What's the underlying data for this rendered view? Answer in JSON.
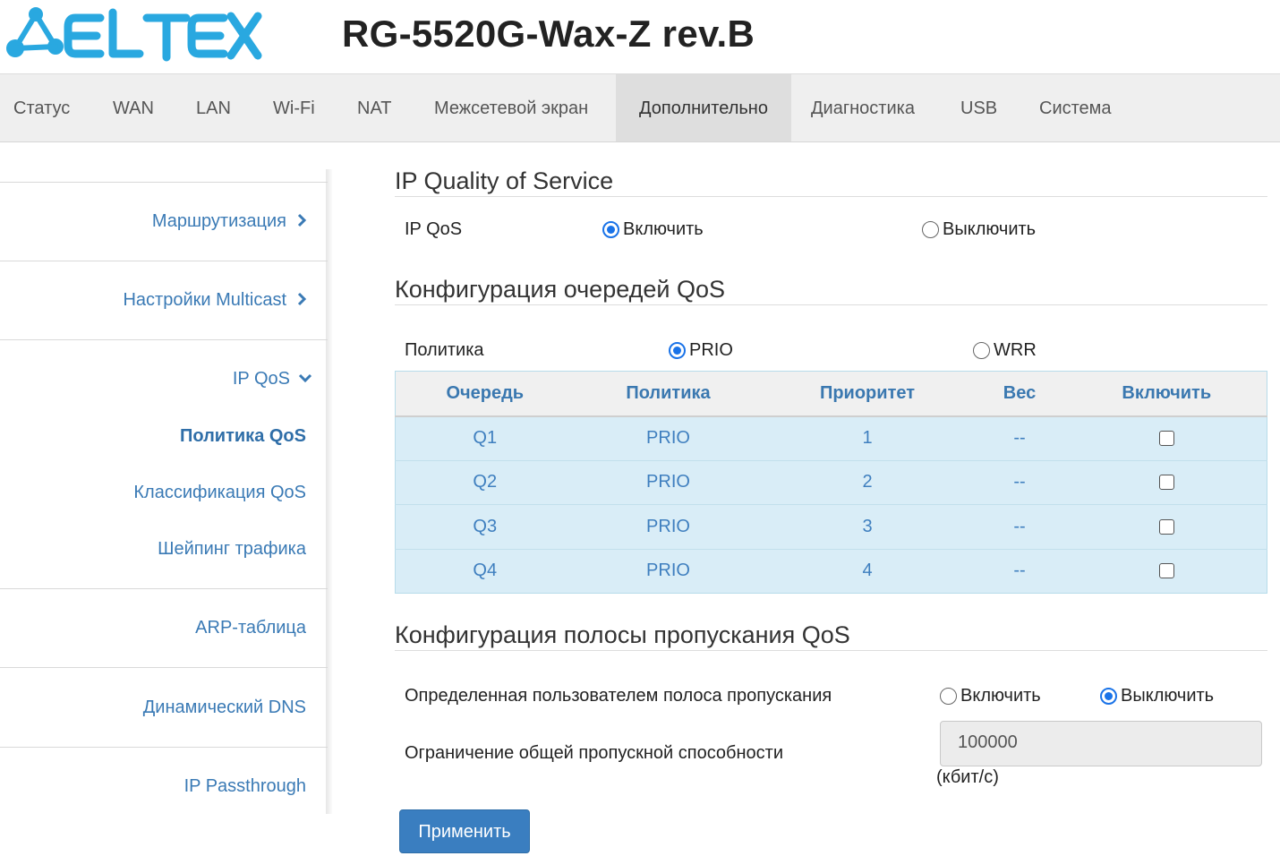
{
  "header": {
    "brand": "ELTEX",
    "model": "RG-5520G-Wax-Z rev.B"
  },
  "colors": {
    "accent": "#3a7ec0",
    "logo": "#29a8e0",
    "table_row": "#d9edf7"
  },
  "topnav": {
    "tabs": [
      "Статус",
      "WAN",
      "LAN",
      "Wi-Fi",
      "NAT",
      "Межсетевой экран",
      "Дополнительно",
      "Диагностика",
      "USB",
      "Система"
    ],
    "active": "Дополнительно"
  },
  "sidebar": {
    "items": [
      {
        "label": "Маршрутизация",
        "icon": "chevron-right-icon"
      },
      {
        "label": "Настройки Multicast",
        "icon": "chevron-right-icon"
      },
      {
        "label": "IP QoS",
        "icon": "chevron-down-icon"
      },
      {
        "label": "Политика QoS",
        "selected": true
      },
      {
        "label": "Классификация QoS"
      },
      {
        "label": "Шейпинг трафика"
      },
      {
        "label": "ARP-таблица"
      },
      {
        "label": "Динамический DNS"
      },
      {
        "label": "IP Passthrough"
      }
    ]
  },
  "ipqos": {
    "title": "IP Quality of Service",
    "label": "IP QoS",
    "enable": "Включить",
    "disable": "Выключить",
    "selected": "enable"
  },
  "queue": {
    "title": "Конфигурация очередей QoS",
    "policy_label": "Политика",
    "options": [
      "PRIO",
      "WRR"
    ],
    "selected": "PRIO",
    "columns": [
      "Очередь",
      "Политика",
      "Приоритет",
      "Вес",
      "Включить"
    ],
    "rows": [
      {
        "queue": "Q1",
        "policy": "PRIO",
        "priority": "1",
        "weight": "--",
        "enabled": false
      },
      {
        "queue": "Q2",
        "policy": "PRIO",
        "priority": "2",
        "weight": "--",
        "enabled": false
      },
      {
        "queue": "Q3",
        "policy": "PRIO",
        "priority": "3",
        "weight": "--",
        "enabled": false
      },
      {
        "queue": "Q4",
        "policy": "PRIO",
        "priority": "4",
        "weight": "--",
        "enabled": false
      }
    ]
  },
  "bandwidth": {
    "title": "Конфигурация полосы пропускания QoS",
    "user_label": "Определенная пользователем полоса пропускания",
    "enable": "Включить",
    "disable": "Выключить",
    "selected": "disable",
    "limit_label": "Ограничение общей пропускной способности",
    "limit_value": "100000",
    "unit": "(кбит/с)"
  },
  "apply_label": "Применить"
}
